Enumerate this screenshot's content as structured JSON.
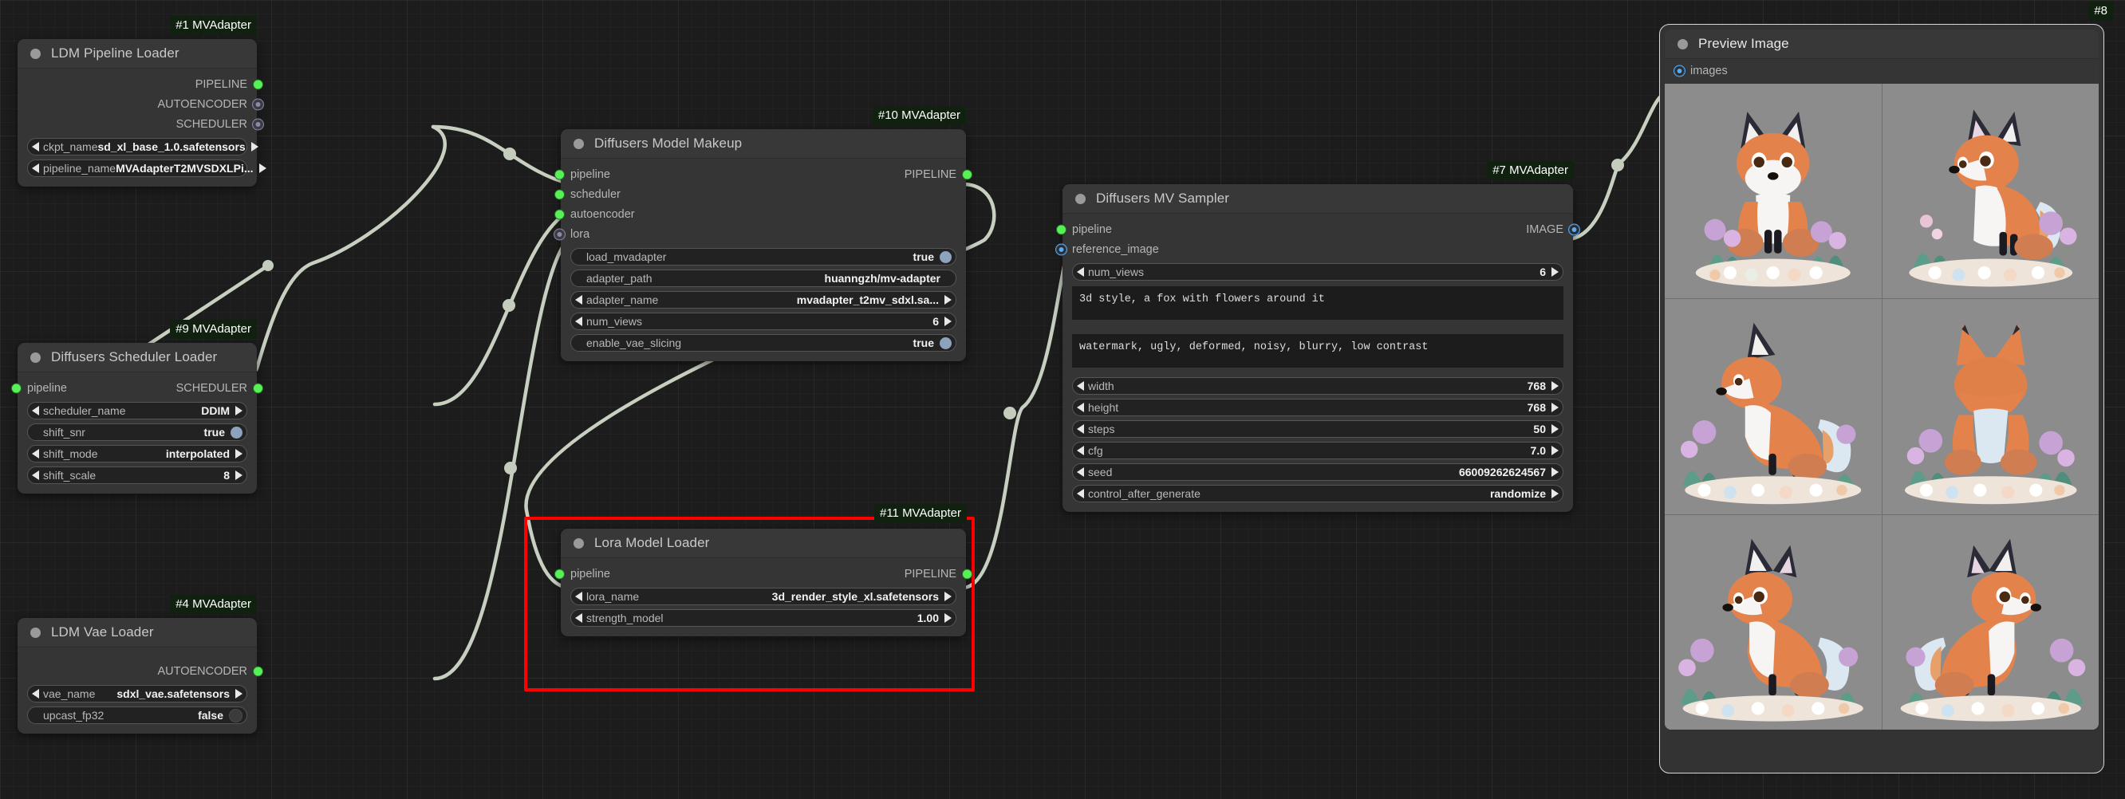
{
  "app": {
    "canvas_name": "comfyui-node-graph"
  },
  "nodes": [
    {
      "badge": "#1 MVAdapter",
      "title": "LDM Pipeline Loader",
      "inputs": [],
      "outputs": [
        {
          "label": "PIPELINE",
          "color": "green"
        },
        {
          "label": "AUTOENCODER",
          "color": "gray"
        },
        {
          "label": "SCHEDULER",
          "color": "gray"
        }
      ],
      "widgets": [
        {
          "type": "combo",
          "label": "ckpt_name",
          "value": "sd_xl_base_1.0.safetensors"
        },
        {
          "type": "combo",
          "label": "pipeline_name",
          "value": "MVAdapterT2MVSDXLPi..."
        }
      ]
    },
    {
      "badge": "#9 MVAdapter",
      "title": "Diffusers Scheduler Loader",
      "inputs": [
        {
          "label": "pipeline",
          "color": "green"
        }
      ],
      "outputs": [
        {
          "label": "SCHEDULER",
          "color": "green"
        }
      ],
      "widgets": [
        {
          "type": "combo",
          "label": "scheduler_name",
          "value": "DDIM"
        },
        {
          "type": "toggle",
          "label": "shift_snr",
          "value": "true",
          "on": true
        },
        {
          "type": "combo",
          "label": "shift_mode",
          "value": "interpolated"
        },
        {
          "type": "combo",
          "label": "shift_scale",
          "value": "8"
        }
      ]
    },
    {
      "badge": "#4 MVAdapter",
      "title": "LDM Vae Loader",
      "inputs": [],
      "outputs": [
        {
          "label": "AUTOENCODER",
          "color": "green"
        }
      ],
      "widgets": [
        {
          "type": "combo",
          "label": "vae_name",
          "value": "sdxl_vae.safetensors"
        },
        {
          "type": "toggle",
          "label": "upcast_fp32",
          "value": "false",
          "on": false
        }
      ]
    },
    {
      "badge": "#10 MVAdapter",
      "title": "Diffusers Model Makeup",
      "inputs": [
        {
          "label": "pipeline",
          "color": "green"
        },
        {
          "label": "scheduler",
          "color": "green"
        },
        {
          "label": "autoencoder",
          "color": "green"
        },
        {
          "label": "lora",
          "color": "gray"
        }
      ],
      "outputs": [
        {
          "label": "PIPELINE",
          "color": "green"
        }
      ],
      "widgets": [
        {
          "type": "toggle",
          "label": "load_mvadapter",
          "value": "true",
          "on": true
        },
        {
          "type": "text",
          "label": "adapter_path",
          "value": "huanngzh/mv-adapter"
        },
        {
          "type": "combo",
          "label": "adapter_name",
          "value": "mvadapter_t2mv_sdxl.sa..."
        },
        {
          "type": "combo",
          "label": "num_views",
          "value": "6"
        },
        {
          "type": "toggle",
          "label": "enable_vae_slicing",
          "value": "true",
          "on": true
        }
      ]
    },
    {
      "badge": "#11 MVAdapter",
      "title": "Lora Model Loader",
      "selected": true,
      "inputs": [
        {
          "label": "pipeline",
          "color": "green"
        }
      ],
      "outputs": [
        {
          "label": "PIPELINE",
          "color": "green"
        }
      ],
      "widgets": [
        {
          "type": "combo",
          "label": "lora_name",
          "value": "3d_render_style_xl.safetensors"
        },
        {
          "type": "combo",
          "label": "strength_model",
          "value": "1.00"
        }
      ]
    },
    {
      "badge": "#7 MVAdapter",
      "title": "Diffusers MV Sampler",
      "inputs": [
        {
          "label": "pipeline",
          "color": "green"
        },
        {
          "label": "reference_image",
          "color": "blue"
        }
      ],
      "outputs": [
        {
          "label": "IMAGE",
          "color": "blue"
        }
      ],
      "widgets": [
        {
          "type": "combo",
          "label": "num_views",
          "value": "6"
        },
        {
          "type": "textarea",
          "value": "3d style, a fox with flowers around it"
        },
        {
          "type": "textarea",
          "value": "watermark, ugly, deformed, noisy, blurry, low contrast"
        },
        {
          "type": "combo",
          "label": "width",
          "value": "768"
        },
        {
          "type": "combo",
          "label": "height",
          "value": "768"
        },
        {
          "type": "combo",
          "label": "steps",
          "value": "50"
        },
        {
          "type": "combo",
          "label": "cfg",
          "value": "7.0"
        },
        {
          "type": "combo",
          "label": "seed",
          "value": "66009262624567"
        },
        {
          "type": "combo",
          "label": "control_after_generate",
          "value": "randomize"
        }
      ]
    }
  ],
  "preview": {
    "badge": "#8",
    "title": "Preview Image",
    "input_label": "images",
    "input_color": "blue",
    "grid_rows": 3,
    "grid_cols": 2,
    "image_alt": "3d style fox with flowers, multi-view render"
  },
  "colors": {
    "node_bg": "#353535",
    "node_title_bg": "#383838",
    "canvas_bg": "#1c1c1c",
    "link": "#c6cfc0",
    "slot_green": "#57f057",
    "slot_blue": "#5aa9f0",
    "slot_gray": "#8a8aa0",
    "selection": "#ff0000",
    "badge_bg": "#10210f"
  }
}
